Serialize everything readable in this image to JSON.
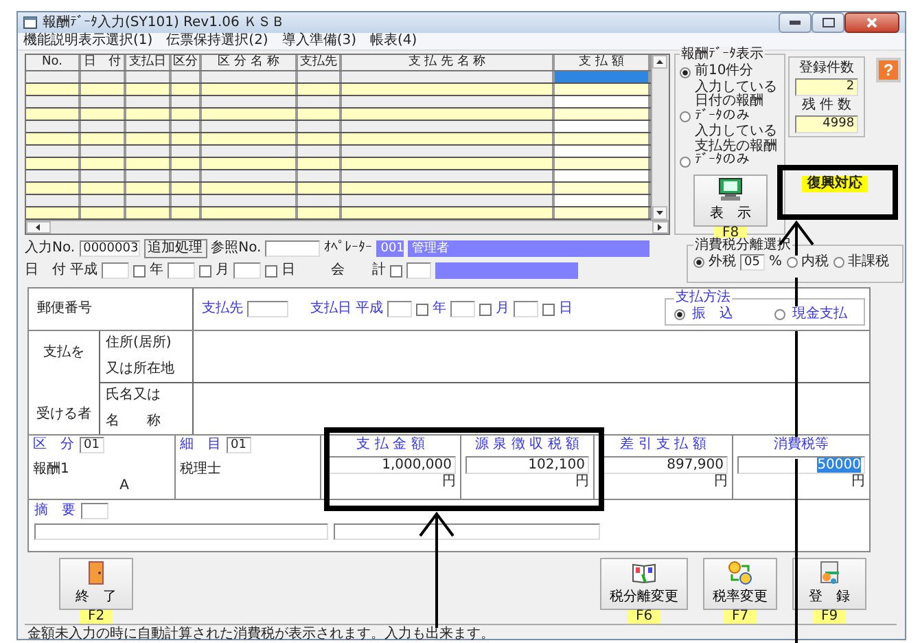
{
  "window": {
    "title": "報酬ﾃﾞｰﾀ入力(SY101) Rev1.06 ＫＳＢ"
  },
  "menu": [
    {
      "label": "機能説明表示選択(1)"
    },
    {
      "label": "伝票保持選択(2)"
    },
    {
      "label": "導入準備(3)"
    },
    {
      "label": "帳表(4)"
    }
  ],
  "grid": {
    "columns": [
      "No.",
      "日　付",
      "支払日",
      "区分",
      "区 分 名 称",
      "支払先",
      "支 払 先 名 称",
      "支 払 額"
    ],
    "rows": [
      {
        "selected": true
      },
      {
        "selected": false
      },
      {
        "selected": false
      },
      {
        "selected": false
      },
      {
        "selected": false
      },
      {
        "selected": false
      },
      {
        "selected": false
      },
      {
        "selected": false
      },
      {
        "selected": false
      },
      {
        "selected": false
      },
      {
        "selected": false
      },
      {
        "selected": false
      }
    ]
  },
  "display": {
    "title": "報酬ﾃﾞｰﾀ表示",
    "options": [
      {
        "lines": [
          "前10件分"
        ],
        "selected": true
      },
      {
        "lines": [
          "入力している",
          "日付の報酬",
          "ﾃﾞｰﾀのみ"
        ],
        "selected": false
      },
      {
        "lines": [
          "入力している",
          "支払先の報酬",
          "ﾃﾞｰﾀのみ"
        ],
        "selected": false
      }
    ],
    "button": {
      "label": "表　示",
      "key": "F8"
    }
  },
  "counts": [
    {
      "label": "登録件数",
      "value": "2"
    },
    {
      "label": "残 件 数",
      "value": "4998"
    }
  ],
  "help_button": {
    "label": "?"
  },
  "badge": {
    "label": "復興対応"
  },
  "entry": {
    "input_no_label": "入力No.",
    "input_no": "0000003",
    "mode": "追加処理",
    "ref_no_label": "参照No.",
    "operator_label": "ｵﾍﾟﾚｰﾀｰ",
    "operator_code": "001",
    "operator_name": "管理者"
  },
  "date_row": {
    "label": "日　付",
    "era": "平成",
    "parts": [
      {
        "unit": "年",
        "checked": false
      },
      {
        "unit": "月",
        "checked": false
      },
      {
        "unit": "日",
        "checked": false
      }
    ],
    "account_label": "会　　計",
    "account_checked": false
  },
  "tax": {
    "title": "消費税分離選択",
    "rate": "05",
    "percent": "%",
    "options": [
      {
        "label": "外税",
        "selected": true
      },
      {
        "label": "内税",
        "selected": false
      },
      {
        "label": "非課税",
        "selected": false
      }
    ]
  },
  "form": {
    "postal_label": "郵便番号",
    "payee_label": "支払先",
    "pay_date_label": "支払日",
    "pay_date_era": "平成",
    "pay_date_parts": [
      {
        "unit": "年",
        "checked": false
      },
      {
        "unit": "月",
        "checked": false
      },
      {
        "unit": "日",
        "checked": false
      }
    ],
    "method": {
      "title": "支払方法",
      "options": [
        {
          "label": "振　込",
          "selected": true
        },
        {
          "label": "現金支払",
          "selected": false
        }
      ]
    },
    "recipient_top": "支払を",
    "recipient_bottom": "受ける者",
    "address_label": [
      "住所(居所)",
      "又は所在地"
    ],
    "name_label": [
      "氏名又は",
      "名　　称"
    ],
    "amounts": [
      {
        "kind": "code",
        "label": "区　分",
        "code": "01",
        "name": "報酬1",
        "sub": "A"
      },
      {
        "kind": "code",
        "label": "細　目",
        "code": "01",
        "name": "税理士"
      },
      {
        "kind": "money",
        "label": "支 払 金 額",
        "value": "1,000,000",
        "unit": "円",
        "selected": false
      },
      {
        "kind": "money",
        "label": "源 泉 徴 収 税 額",
        "value": "102,100",
        "unit": "円",
        "selected": false
      },
      {
        "kind": "money",
        "label": "差 引 支 払 額",
        "value": "897,900",
        "unit": "円",
        "selected": false
      },
      {
        "kind": "money",
        "label": "消費税等",
        "value": "50000",
        "unit": "円",
        "selected": true
      }
    ],
    "memo_label": "摘　要"
  },
  "buttons": [
    {
      "label": "終　了",
      "key": "F2"
    },
    {
      "label": "税分離変更",
      "key": "F6"
    },
    {
      "label": "税率変更",
      "key": "F7"
    },
    {
      "label": "登　録",
      "key": "F9"
    }
  ],
  "status_bar": "金額未入力の時に自動計算された消費税が表示されます。入力も出来ます。"
}
